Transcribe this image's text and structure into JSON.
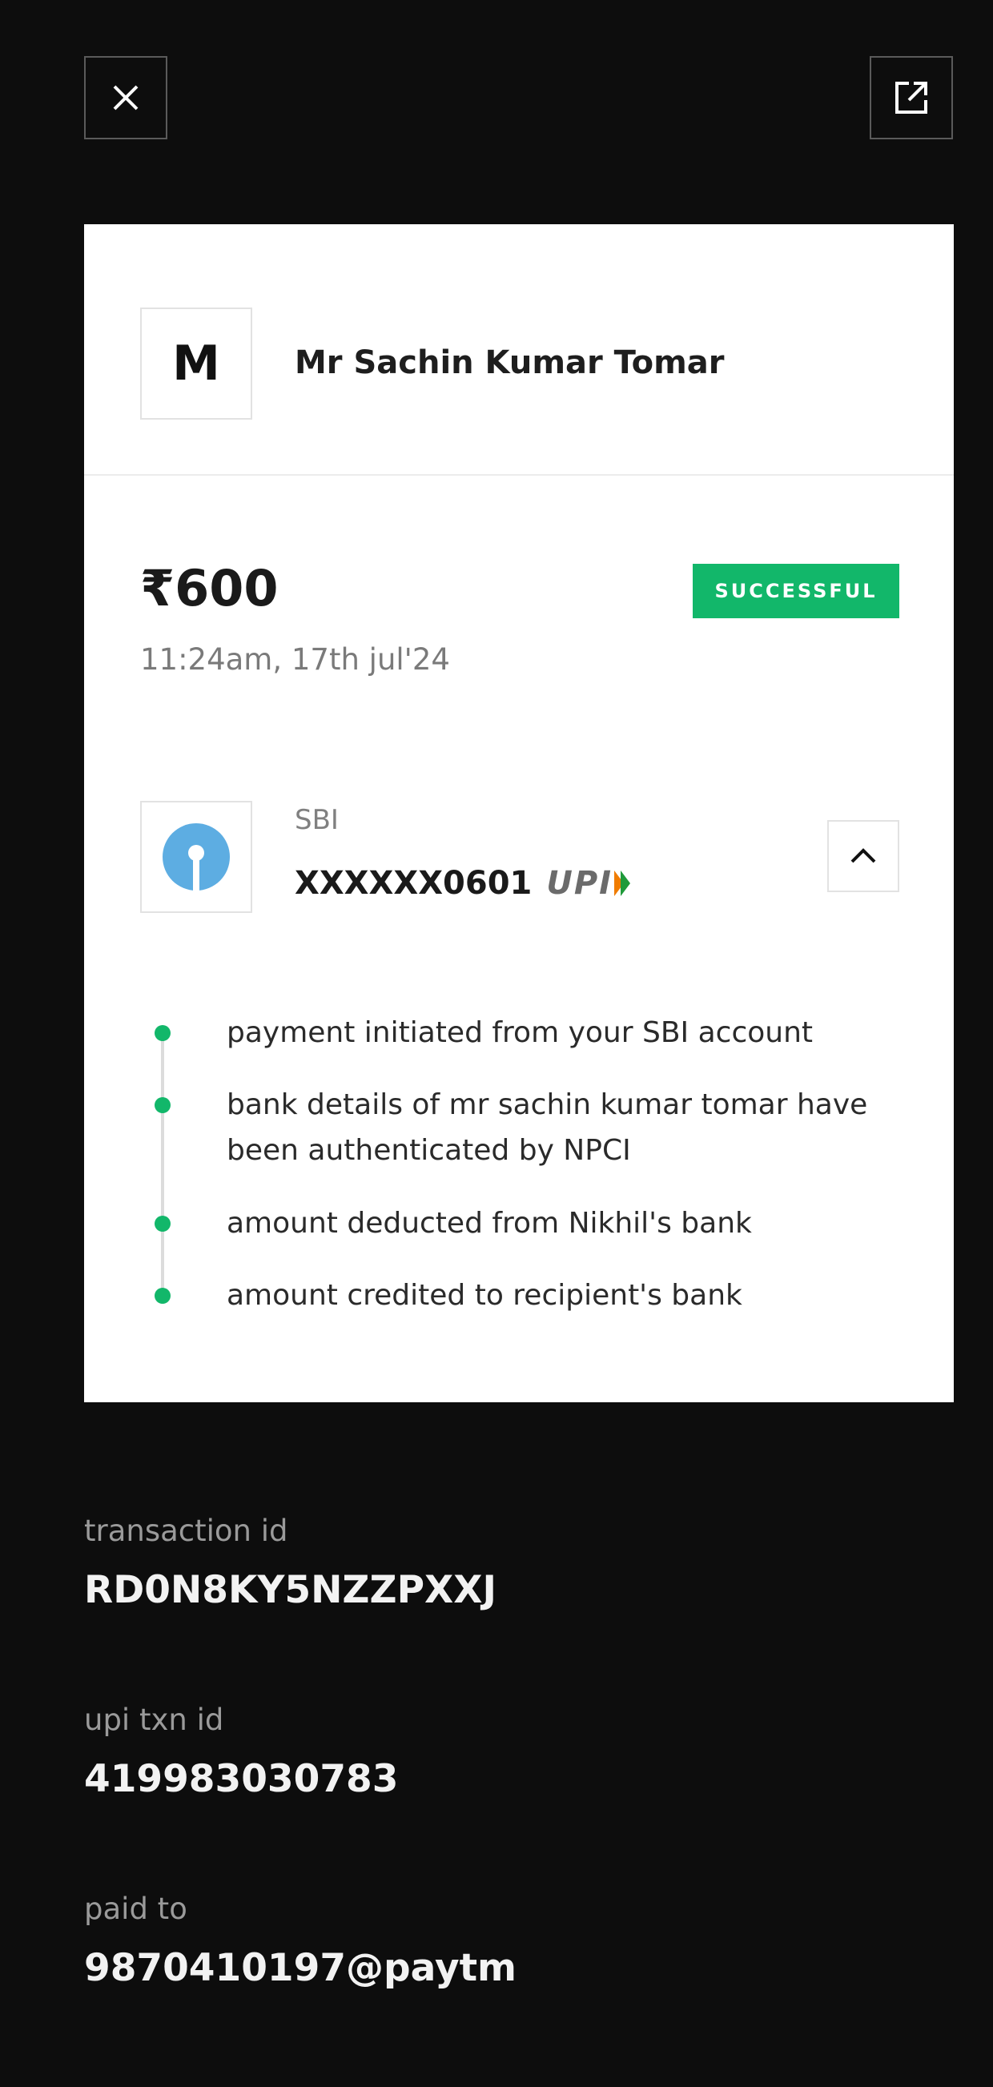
{
  "icons": {
    "close": "close-icon",
    "share": "external-link-icon",
    "bank_logo": "sbi-logo-icon",
    "collapse": "chevron-up-icon",
    "upi": "upi-logo"
  },
  "colors": {
    "background": "#0d0d0d",
    "card": "#ffffff",
    "success": "#12b76a",
    "sbi_blue": "#5dade2"
  },
  "payee": {
    "initial": "M",
    "name": "Mr Sachin Kumar Tomar"
  },
  "payment": {
    "amount": "₹600",
    "datetime": "11:24am, 17th jul'24",
    "status": "SUCCESSFUL"
  },
  "bank": {
    "name": "SBI",
    "account": "XXXXXX0601",
    "upi_label": "UPI"
  },
  "timeline": [
    "payment initiated from your SBI account",
    "bank details of mr sachin kumar tomar have been authenticated by NPCI",
    "amount deducted from Nikhil's bank",
    "amount credited to recipient's bank"
  ],
  "details": {
    "transaction_id_label": "transaction id",
    "transaction_id": "RD0N8KY5NZZPXXJ",
    "upi_txn_id_label": "upi txn id",
    "upi_txn_id": "419983030783",
    "paid_to_label": "paid to",
    "paid_to": "9870410197@paytm"
  }
}
